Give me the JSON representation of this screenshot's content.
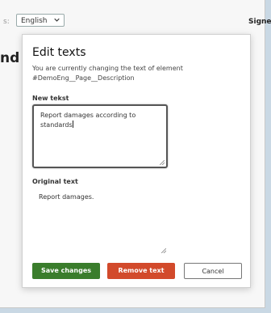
{
  "header": {
    "left_fragment": "s:",
    "language": "English",
    "sign_fragment": "Signe"
  },
  "background": {
    "left_fragment": "nd"
  },
  "dialog": {
    "title": "Edit texts",
    "description": "You are currently changing the text of element #DemoEng__Page__Description",
    "new_text_label": "New tekst",
    "new_text_value": "Report damages according to standards",
    "original_label": "Original text",
    "original_value": "Report damages.",
    "buttons": {
      "save": "Save changes",
      "remove": "Remove text",
      "cancel": "Cancel"
    }
  },
  "colors": {
    "save": "#3a7d2c",
    "remove": "#d24a2b"
  }
}
